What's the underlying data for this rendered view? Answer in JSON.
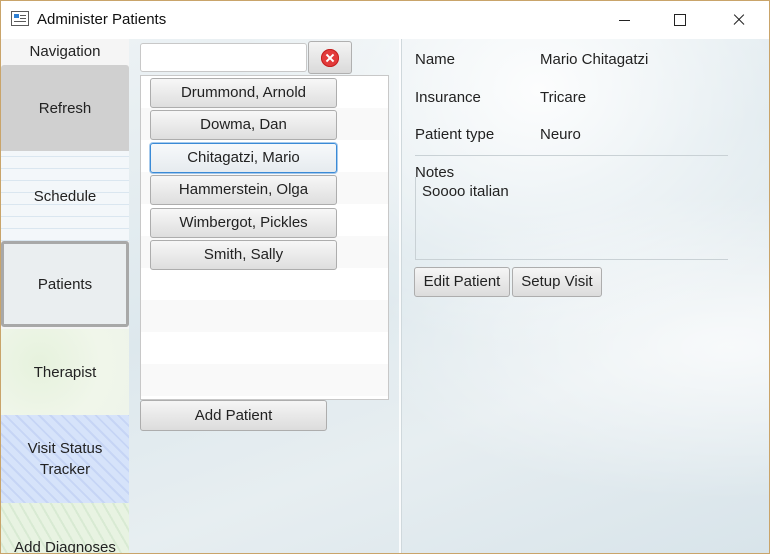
{
  "window": {
    "title": "Administer Patients"
  },
  "navigation": {
    "header": "Navigation",
    "items": [
      {
        "label": "Refresh"
      },
      {
        "label": "Schedule"
      },
      {
        "label": "Patients"
      },
      {
        "label": "Therapist"
      },
      {
        "label": "Visit Status Tracker"
      },
      {
        "label": "Add Diagnoses"
      }
    ]
  },
  "search": {
    "value": "",
    "placeholder": ""
  },
  "patients": {
    "list": [
      "Drummond, Arnold",
      "Dowma, Dan",
      "Chitagatzi, Mario",
      "Hammerstein, Olga",
      "Wimbergot, Pickles",
      "Smith, Sally"
    ],
    "selected_name": "Chitagatzi, Mario",
    "add_label": "Add Patient"
  },
  "details": {
    "name_label": "Name",
    "name_value": "Mario Chitagatzi",
    "insurance_label": "Insurance",
    "insurance_value": "Tricare",
    "type_label": "Patient type",
    "type_value": "Neuro",
    "notes_label": "Notes",
    "notes_value": "Soooo italian",
    "edit_label": "Edit Patient",
    "setup_label": "Setup Visit"
  },
  "colors": {
    "selection_border": "#3a8ad6",
    "clear_icon": "#e23b3b",
    "title_border": "#c9a46a"
  },
  "icons": {
    "app": "app-window-icon",
    "clear": "clear-circle-x-icon",
    "minimize": "minimize-icon",
    "maximize": "maximize-icon",
    "close": "close-icon"
  }
}
